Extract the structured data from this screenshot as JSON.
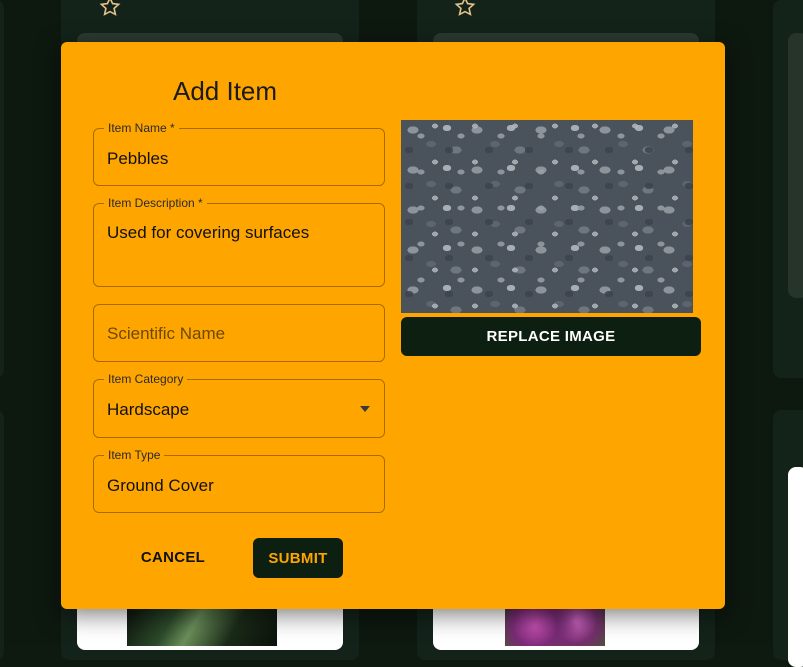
{
  "dialog": {
    "title": "Add Item",
    "fields": {
      "item_name": {
        "label": "Item Name *",
        "value": "Pebbles"
      },
      "item_description": {
        "label": "Item Description *",
        "value": "Used for covering surfaces"
      },
      "scientific_name": {
        "placeholder": "Scientific Name"
      },
      "item_category": {
        "label": "Item Category",
        "value": "Hardscape"
      },
      "item_type": {
        "label": "Item Type",
        "value": "Ground Cover"
      }
    },
    "image": {
      "description": "pebbles-photo"
    },
    "replace_image_label": "REPLACE IMAGE",
    "cancel_label": "CANCEL",
    "submit_label": "SUBMIT"
  },
  "colors": {
    "dialog_bg": "#ffa500",
    "background": "#0d180f",
    "button_dark": "#0d1f10"
  },
  "icons": [
    "star-outline-icon",
    "chevron-down-icon"
  ]
}
